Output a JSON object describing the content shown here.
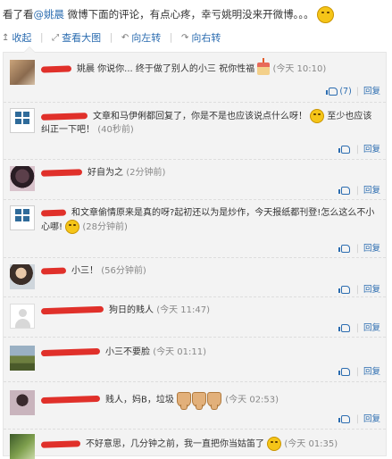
{
  "header": {
    "text_before": "看了看",
    "mention": "@姚晨",
    "text_after": " 微博下面的评论，有点心疼，幸亏姚明没来开微博。。。",
    "emoticon": "smile-emoji"
  },
  "toolbar": {
    "collapse": "收起",
    "view_large": "查看大图",
    "rotate_left": "向左转",
    "rotate_right": "向右转"
  },
  "comments": [
    {
      "text": "姚晨 你说你... 终于做了别人的小三 祝你性福",
      "time": "(今天 10:10)",
      "like": "(7)",
      "reply": "回复"
    },
    {
      "text": "文章和马伊俐都回复了，你是不是也应该说点什么呀！",
      "text2": "至少也应该纠正一下吧！",
      "time": "(40秒前)",
      "reply": "回复"
    },
    {
      "text": "好自为之",
      "time": "(2分钟前)",
      "reply": "回复"
    },
    {
      "text": "和文章偷情原来是真的呀?起初还以为是炒作，今天报纸都刊登!怎么这么不小心哪!",
      "time": "(28分钟前)",
      "reply": "回复"
    },
    {
      "text": "小三！",
      "time": "(56分钟前)",
      "reply": "回复"
    },
    {
      "text": "狗日的贱人",
      "time": "(今天 11:47)",
      "reply": "回复"
    },
    {
      "text": "小三不要脸",
      "time": "(今天 01:11)",
      "reply": "回复"
    },
    {
      "text": "贱人，妈B，垃圾",
      "time": "(今天 02:53)",
      "reply": "回复"
    },
    {
      "text": "不好意思，几分钟之前，我一直把你当姑笛了",
      "time": "(今天 01:35)",
      "reply": "回复"
    }
  ]
}
